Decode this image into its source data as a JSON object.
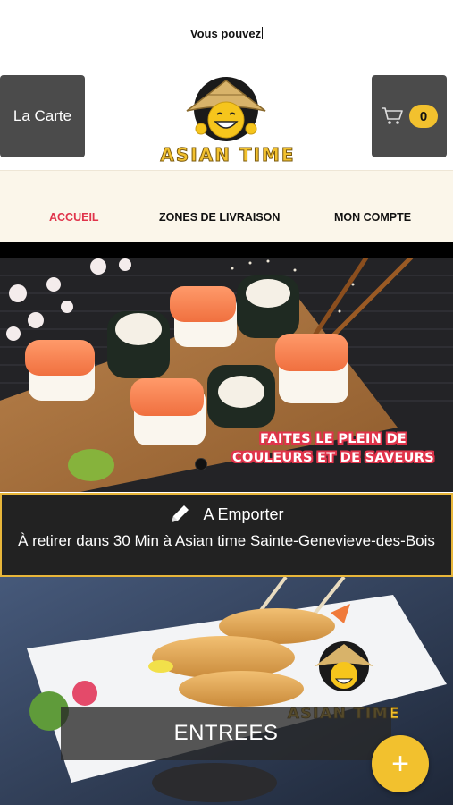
{
  "ticker": {
    "text": "Vous pouvez"
  },
  "header": {
    "menu_label": "La Carte",
    "cart_count": "0",
    "logo_text": "ASIAN TIME"
  },
  "nav": {
    "items": [
      {
        "label": "ACCUEIL",
        "active": true
      },
      {
        "label": "ZONES DE LIVRAISON",
        "active": false
      },
      {
        "label": "MON COMPTE",
        "active": false
      }
    ]
  },
  "hero": {
    "slogan_line1": "FAITES LE PLEIN DE",
    "slogan_line2": "COULEURS ET DE SAVEURS"
  },
  "pickup": {
    "title": "A Emporter",
    "text": "À retirer dans 30 Min à Asian time Sainte-Genevieve-des-Bois"
  },
  "category": {
    "label": "ENTREES",
    "logo_text": "ASIAN TIME"
  },
  "fab": {
    "icon": "+"
  },
  "colors": {
    "accent": "#f2c12e",
    "active_nav": "#e0344b",
    "button_bg": "#4b4b4b",
    "nav_bg": "#fbf6ea"
  }
}
